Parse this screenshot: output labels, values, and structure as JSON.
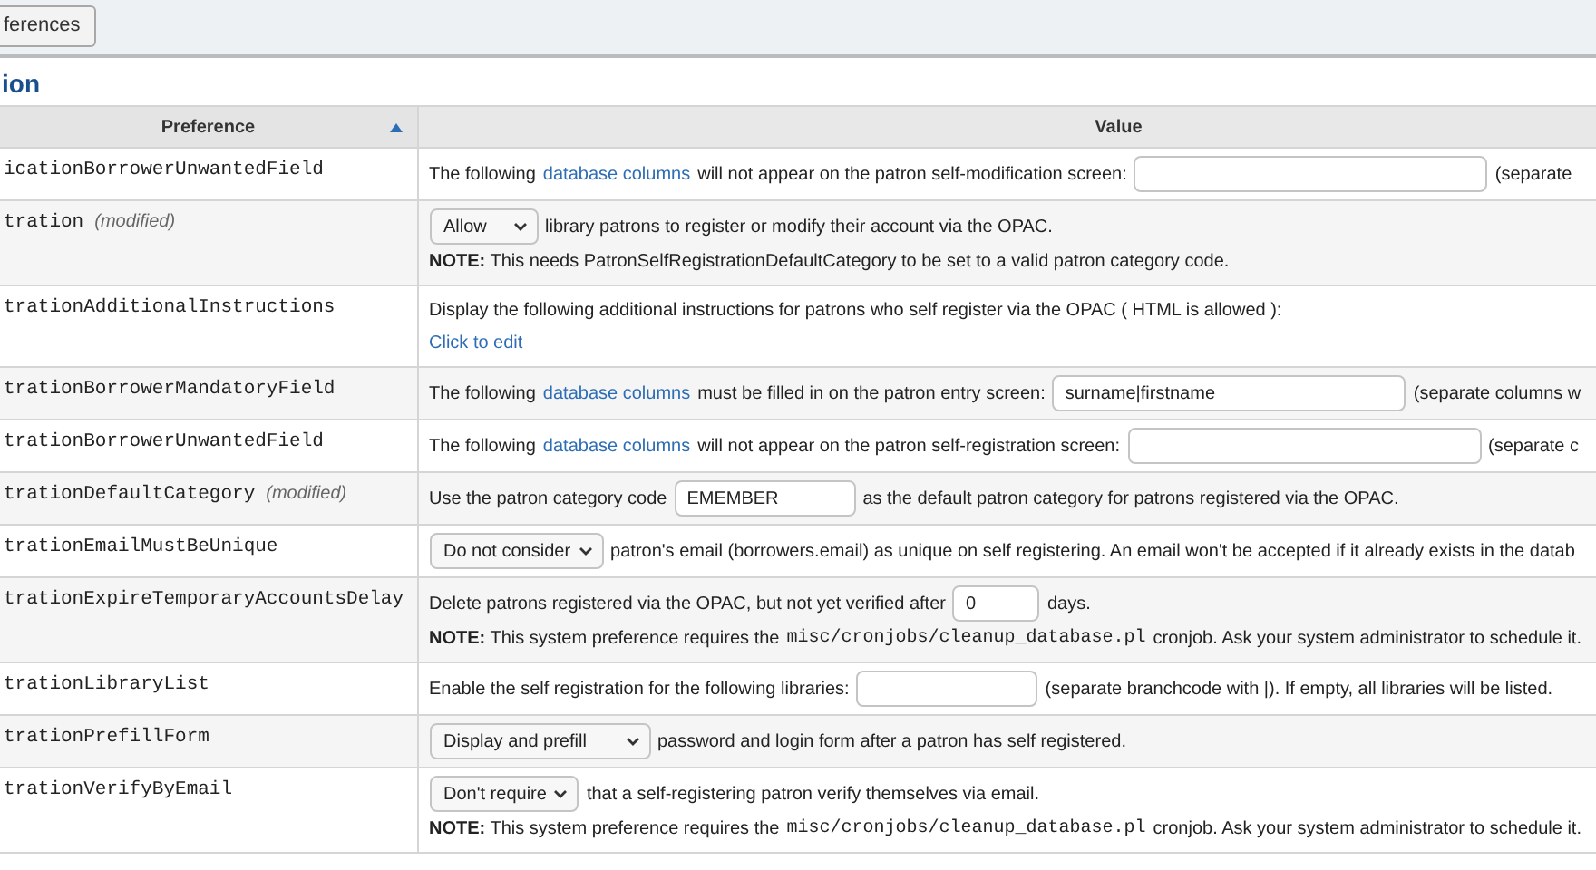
{
  "toolbar": {
    "button": "ferences"
  },
  "section_title": "ion",
  "table": {
    "columns": [
      {
        "label": "Preference",
        "sorted": true
      },
      {
        "label": "Value"
      }
    ],
    "rows": [
      {
        "name": "icationBorrowerUnwantedField",
        "lines": [
          [
            {
              "kind": "text",
              "text": "The following"
            },
            {
              "kind": "link",
              "text": "database columns"
            },
            {
              "kind": "text",
              "text": "will not appear on the patron self-modification screen:"
            },
            {
              "kind": "field"
            },
            {
              "kind": "text",
              "text": "(separate"
            }
          ]
        ]
      },
      {
        "name": "tration",
        "modified": "(modified)",
        "lines": [
          [
            {
              "kind": "select",
              "value": "Allow"
            },
            {
              "kind": "text",
              "text": "library patrons to register or modify their account via the OPAC."
            }
          ],
          [
            {
              "kind": "text",
              "text": "**NOTE:** This needs PatronSelfRegistrationDefaultCategory to be set to a valid patron category code."
            }
          ]
        ]
      },
      {
        "name": "trationAdditionalInstructions",
        "lines": [
          [
            {
              "kind": "text",
              "text": "Display the following additional instructions for patrons who self register via the OPAC ( HTML is allowed ):"
            }
          ],
          [
            {
              "kind": "link",
              "text": "Click to edit"
            }
          ]
        ]
      },
      {
        "name": "trationBorrowerMandatoryField",
        "lines": [
          [
            {
              "kind": "text",
              "text": "The following"
            },
            {
              "kind": "link",
              "text": "database columns"
            },
            {
              "kind": "text",
              "text": "must be filled in on the patron entry screen:"
            },
            {
              "kind": "field",
              "value": "surname|firstname"
            },
            {
              "kind": "text",
              "text": "(separate columns w"
            }
          ]
        ]
      },
      {
        "name": "trationBorrowerUnwantedField",
        "lines": [
          [
            {
              "kind": "text",
              "text": "The following"
            },
            {
              "kind": "link",
              "text": "database columns"
            },
            {
              "kind": "text",
              "text": "will not appear on the patron self-registration screen:"
            },
            {
              "kind": "field"
            },
            {
              "kind": "text",
              "text": "(separate c"
            }
          ]
        ]
      },
      {
        "name": "trationDefaultCategory",
        "modified": "(modified)",
        "lines": [
          [
            {
              "kind": "text",
              "text": "Use the patron category code"
            },
            {
              "kind": "short-field",
              "value": "EMEMBER"
            },
            {
              "kind": "text",
              "text": "as the default patron category for patrons registered via the OPAC."
            }
          ]
        ]
      },
      {
        "name": "trationEmailMustBeUnique",
        "lines": [
          [
            {
              "kind": "select",
              "value": "Do not consider"
            },
            {
              "kind": "text",
              "text": "patron's email (borrowers.email) as unique on self registering. An email won't be accepted if it already exists in the datab"
            }
          ]
        ]
      },
      {
        "name": "trationExpireTemporaryAccountsDelay",
        "lines": [
          [
            {
              "kind": "text",
              "text": "Delete patrons registered via the OPAC, but not yet verified after"
            },
            {
              "kind": "tiny-field",
              "value": "0"
            },
            {
              "kind": "text",
              "text": "days."
            }
          ],
          [
            {
              "kind": "text",
              "text": "**NOTE:** This system preference requires the"
            },
            {
              "kind": "code",
              "text": "misc/cronjobs/cleanup_database.pl"
            },
            {
              "kind": "text",
              "text": "cronjob. Ask your system administrator to schedule it."
            }
          ]
        ]
      },
      {
        "name": "trationLibraryList",
        "lines": [
          [
            {
              "kind": "text",
              "text": "Enable the self registration for the following libraries:"
            },
            {
              "kind": "short-field"
            },
            {
              "kind": "text",
              "text": "(separate branchcode with |). If empty, all libraries will be listed."
            }
          ]
        ]
      },
      {
        "name": "trationPrefillForm",
        "lines": [
          [
            {
              "kind": "wide-select",
              "value": "Display and prefill"
            },
            {
              "kind": "text",
              "text": "password and login form after a patron has self registered."
            }
          ]
        ]
      },
      {
        "name": "trationVerifyByEmail",
        "lines": [
          [
            {
              "kind": "select",
              "value": "Don't require"
            },
            {
              "kind": "text",
              "text": "that a self-registering patron verify themselves via email."
            }
          ],
          [
            {
              "kind": "text",
              "text": "**NOTE:** This system preference requires the"
            },
            {
              "kind": "code",
              "text": "misc/cronjobs/cleanup_database.pl"
            },
            {
              "kind": "text",
              "text": "cronjob. Ask your system administrator to schedule it."
            }
          ]
        ]
      }
    ]
  }
}
